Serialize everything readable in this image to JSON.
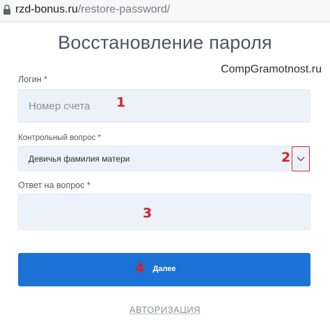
{
  "browser": {
    "url_host": "rzd-bonus.ru",
    "url_path": "/restore-password/",
    "lock_icon": "lock-icon"
  },
  "page": {
    "title": "Восстановление пароля",
    "watermark": "CompGramotnost.ru"
  },
  "form": {
    "login": {
      "label": "Логин *",
      "placeholder": "Номер счета",
      "value": ""
    },
    "security_question": {
      "label": "Контрольный вопрос *",
      "selected": "Девичья фамилия матери",
      "dropdown_icon": "chevron-down-icon"
    },
    "answer": {
      "label": "Ответ на вопрос *",
      "value": ""
    },
    "next_button": "Далее",
    "auth_link": "АВТОРИЗАЦИЯ"
  },
  "annotations": {
    "n1": "1",
    "n2": "2",
    "n3": "3",
    "n4": "4"
  },
  "colors": {
    "accent": "#1d72d6",
    "annotation": "#d3202a",
    "field_bg": "#edf1f9"
  }
}
